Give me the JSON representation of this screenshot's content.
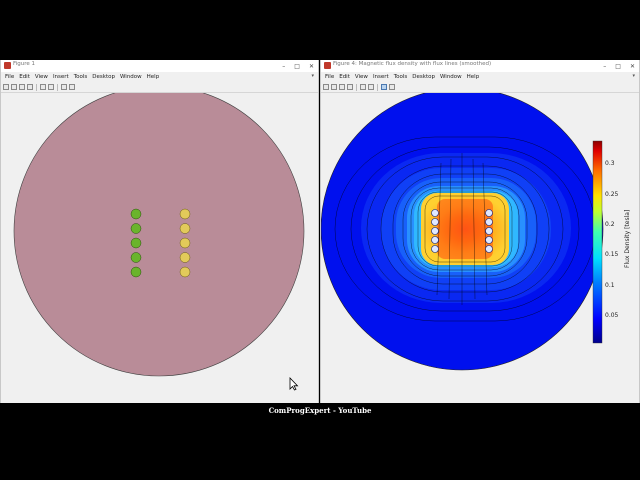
{
  "figure1": {
    "title": "Figure 1",
    "menu": [
      "File",
      "Edit",
      "View",
      "Insert",
      "Tools",
      "Desktop",
      "Window",
      "Help"
    ],
    "colors": {
      "disc": "#b98c98",
      "left_conductors": "#6ab42c",
      "right_conductors": "#e2ca5a"
    }
  },
  "figure4": {
    "title": "Figure 4: Magnetic flux density with flux lines (smoothed)",
    "menu": [
      "File",
      "Edit",
      "View",
      "Insert",
      "Tools",
      "Desktop",
      "Window",
      "Help"
    ],
    "colorbar": {
      "label": "Flux Density [tesla]",
      "ticks": [
        "0.3",
        "0.25",
        "0.2",
        "0.15",
        "0.1",
        "0.05"
      ]
    }
  },
  "window_controls": {
    "minimize": "–",
    "maximize": "□",
    "close": "✕"
  },
  "caption": "ComProgExpert - YouTube"
}
